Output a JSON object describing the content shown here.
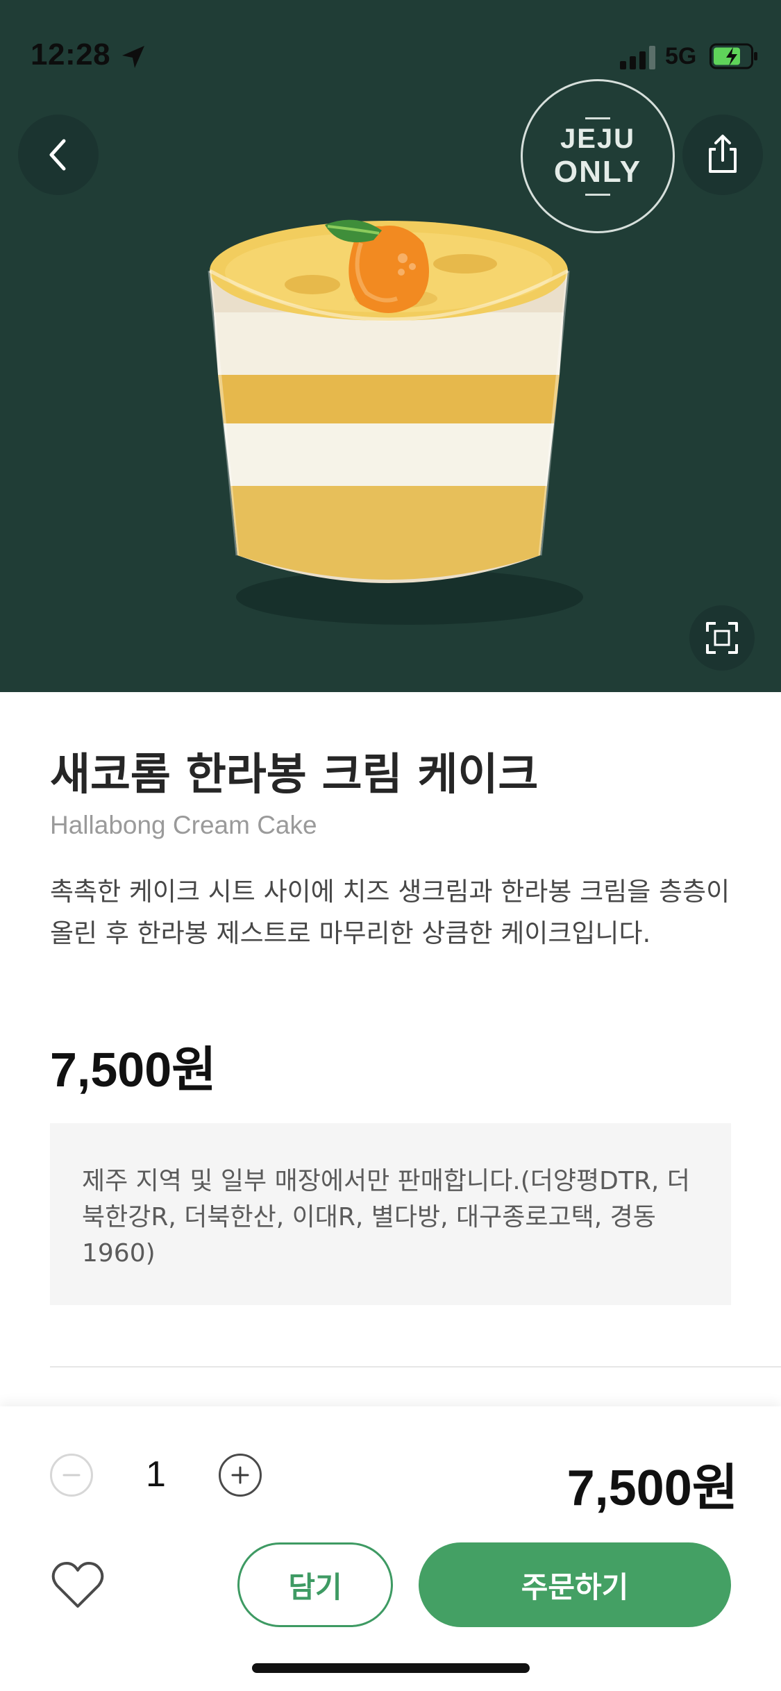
{
  "status_bar": {
    "time": "12:28",
    "network": "5G"
  },
  "badge": {
    "line1": "JEJU",
    "line2": "ONLY"
  },
  "product": {
    "name_ko": "새코롬 한라봉 크림 케이크",
    "name_en": "Hallabong Cream Cake",
    "description": "촉촉한 케이크 시트 사이에 치즈 생크림과 한라봉 크림을 층층이 올린 후 한라봉 제스트로 마무리한 상큼한 케이크입니다.",
    "price": "7,500원",
    "notice": "제주 지역 및 일부 매장에서만 판매합니다.(더양평DTR, 더북한강R, 더북한산, 이대R, 별다방, 대구종로고택, 경동1960)"
  },
  "order": {
    "quantity": "1",
    "total": "7,500원",
    "cart_label": "담기",
    "order_label": "주문하기"
  },
  "icons": {
    "back": "chevron-left-icon",
    "share": "share-icon",
    "fullscreen": "fullscreen-icon",
    "favorite": "heart-icon",
    "minus": "minus-icon",
    "plus": "plus-icon"
  },
  "colors": {
    "hero_bg": "#203d36",
    "accent": "#44a064"
  }
}
